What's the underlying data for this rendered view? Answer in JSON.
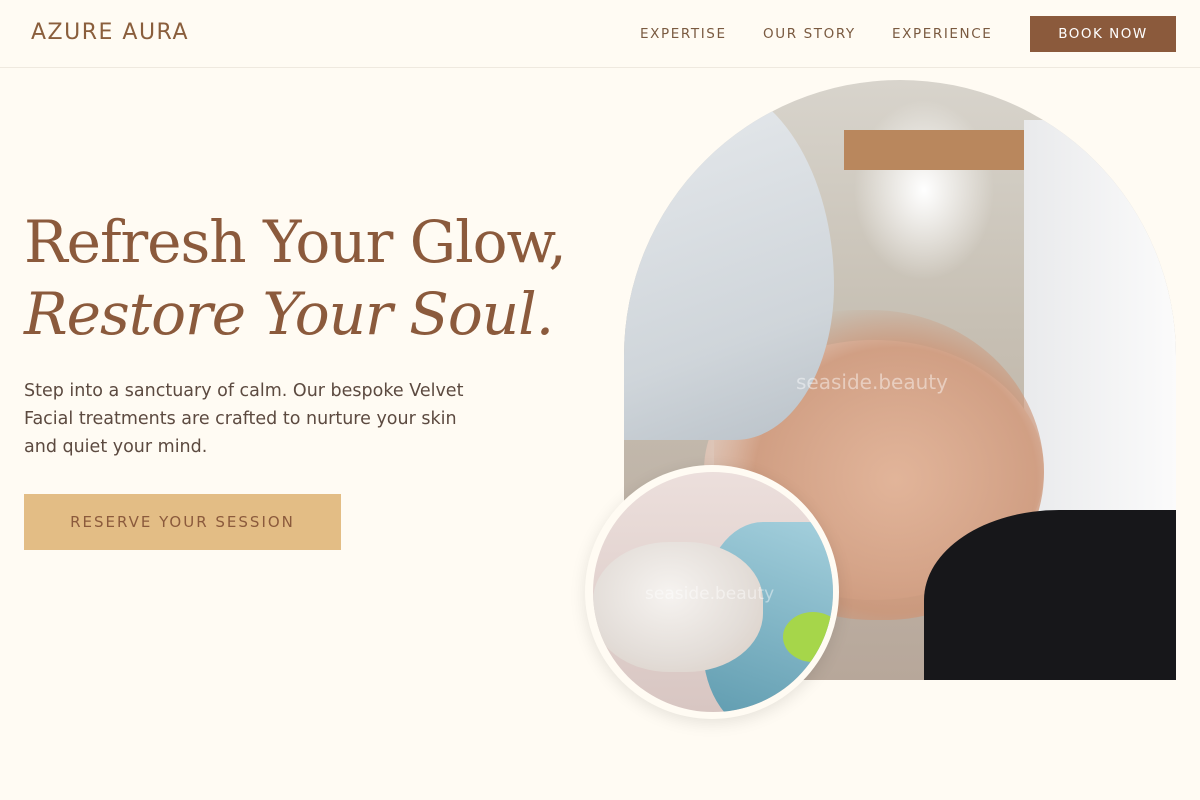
{
  "brand": {
    "name": "AZURE AURA"
  },
  "nav": {
    "items": [
      "EXPERTISE",
      "OUR STORY",
      "EXPERIENCE"
    ],
    "cta": "BOOK NOW"
  },
  "hero": {
    "headline_line1": "Refresh Your Glow,",
    "headline_line2": "Restore Your Soul.",
    "intro": "Step into a sanctuary of calm. Our bespoke Velvet Facial treatments are crafted to nurture your skin and quiet your mind.",
    "cta": "RESERVE YOUR SESSION",
    "image_watermark": "seaside.beauty",
    "inset_watermark": "seaside.beauty"
  },
  "colors": {
    "background": "#fffbf3",
    "brand_brown": "#8b5a3c",
    "accent_gold": "#e3bd85",
    "body_text": "#5c4a40"
  }
}
